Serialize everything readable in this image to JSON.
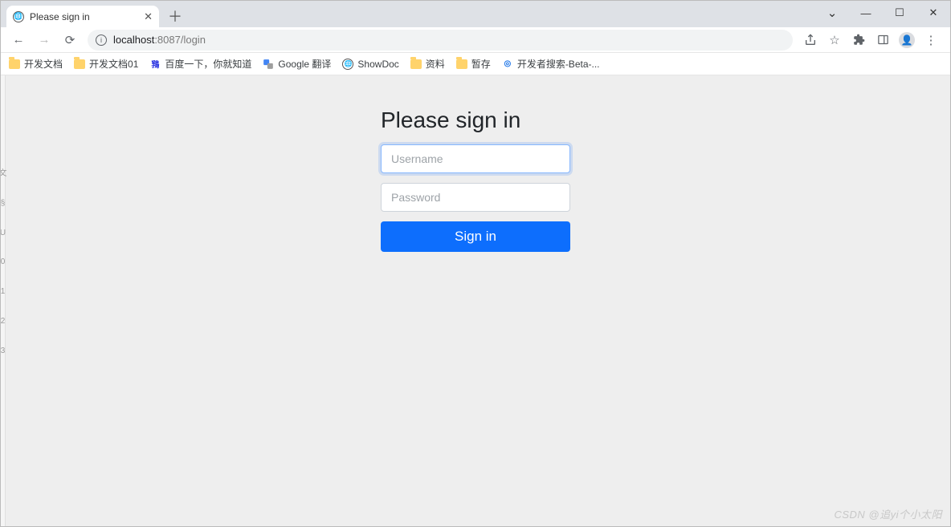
{
  "window": {
    "tab_title": "Please sign in",
    "url_host": "localhost",
    "url_port_path": ":8087/login"
  },
  "bookmarks": [
    {
      "label": "开发文档",
      "icon": "folder"
    },
    {
      "label": "开发文档01",
      "icon": "folder"
    },
    {
      "label": "百度一下，你就知道",
      "icon": "baidu"
    },
    {
      "label": "Google 翻译",
      "icon": "gtranslate"
    },
    {
      "label": "ShowDoc",
      "icon": "globe"
    },
    {
      "label": "资料",
      "icon": "folder"
    },
    {
      "label": "暂存",
      "icon": "folder"
    },
    {
      "label": "开发者搜索-Beta-...",
      "icon": "target"
    }
  ],
  "form": {
    "title": "Please sign in",
    "username_placeholder": "Username",
    "password_placeholder": "Password",
    "submit_label": "Sign in"
  },
  "watermark": "CSDN @追yi个小太阳"
}
